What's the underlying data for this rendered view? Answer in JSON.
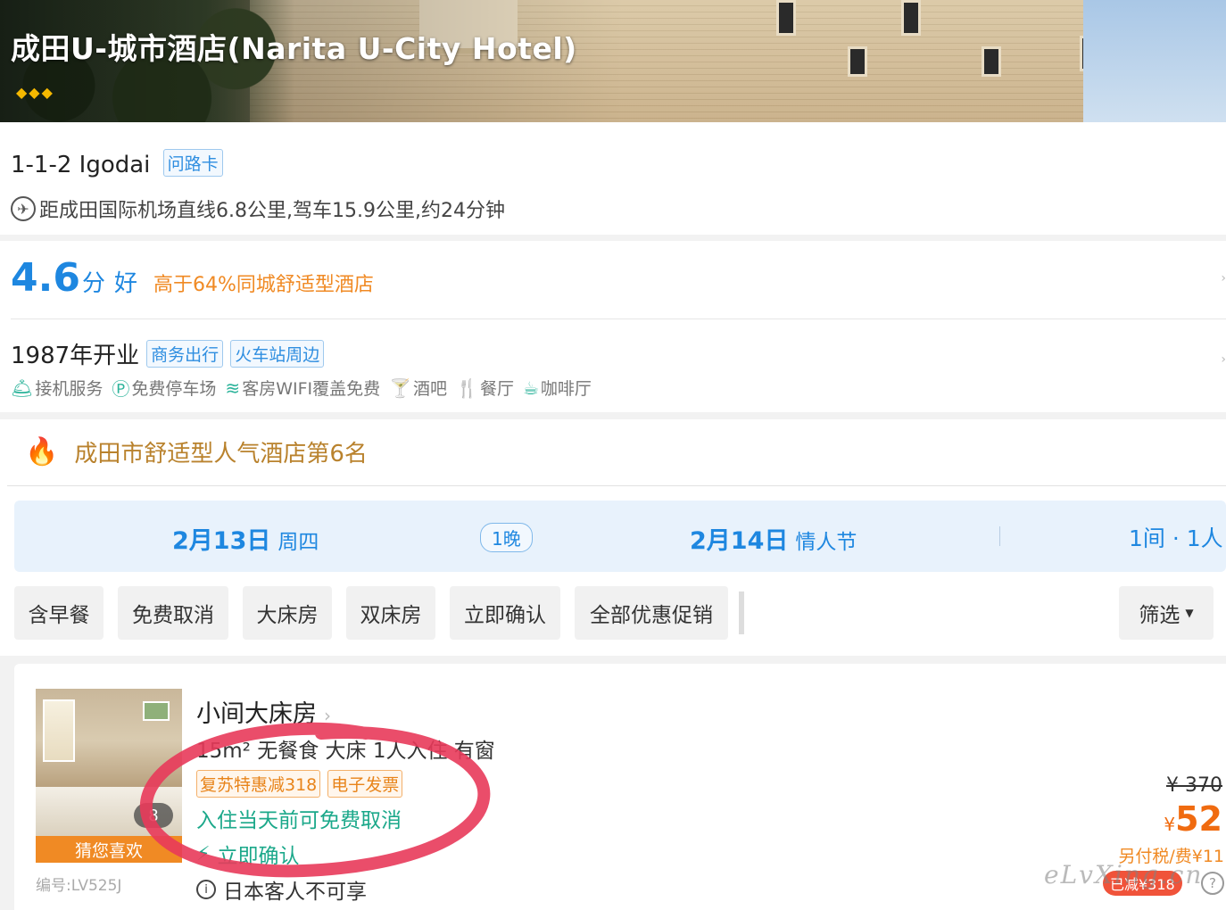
{
  "hotel": {
    "title": "成田U-城市酒店(Narita U-City Hotel)",
    "diamonds": "◆◆◆",
    "address": "1-1-2 Igodai",
    "address_tag": "问路卡",
    "distance": "距成田国际机场直线6.8公里,驾车15.9公里,约24分钟"
  },
  "rating": {
    "score": "4.6",
    "unit": "分",
    "label": "好",
    "rank_text": "高于64%同城舒适型酒店"
  },
  "info": {
    "opened": "1987年开业",
    "tags": [
      "商务出行",
      "火车站周边"
    ],
    "amenities": [
      {
        "icon": "shuttle-icon",
        "glyph": "🛎",
        "label": "接机服务"
      },
      {
        "icon": "parking-icon",
        "glyph": "Ⓟ",
        "label": "免费停车场"
      },
      {
        "icon": "wifi-icon",
        "glyph": "≋",
        "label": "客房WIFI覆盖免费"
      },
      {
        "icon": "bar-icon",
        "glyph": "🍸",
        "label": "酒吧"
      },
      {
        "icon": "restaurant-icon",
        "glyph": "🍴",
        "label": "餐厅"
      },
      {
        "icon": "cafe-icon",
        "glyph": "☕",
        "label": "咖啡厅"
      }
    ]
  },
  "ranking": {
    "text": "成田市舒适型人气酒店第6名"
  },
  "booking": {
    "checkin_date": "2月13日",
    "checkin_day": "周四",
    "nights": "1晚",
    "checkout_date": "2月14日",
    "checkout_day": "情人节",
    "rooms": "1间 · 1人"
  },
  "filters": [
    "含早餐",
    "免费取消",
    "大床房",
    "双床房",
    "立即确认",
    "全部优惠促销"
  ],
  "filter_button": "筛选",
  "room": {
    "name": "小间大床房",
    "spec": "15m² 无餐食 大床 1人入住 有窗",
    "tags": [
      "复苏特惠减318",
      "电子发票"
    ],
    "cancel": "入住当天前可免费取消",
    "confirm": "立即确认",
    "notice": "日本客人不可享",
    "image_count": "8",
    "image_badge": "猜您喜欢",
    "code": "编号:LV525J",
    "original_price": "¥ 370",
    "currency": "¥",
    "price": "52",
    "tax": "另付税/费¥11",
    "promo": "已减¥318"
  },
  "watermark": "eLvXing.cn",
  "colors": {
    "accent_blue": "#1e87e0",
    "orange": "#f08a24",
    "green": "#1ba88a",
    "red_circle": "#e83a5a"
  }
}
